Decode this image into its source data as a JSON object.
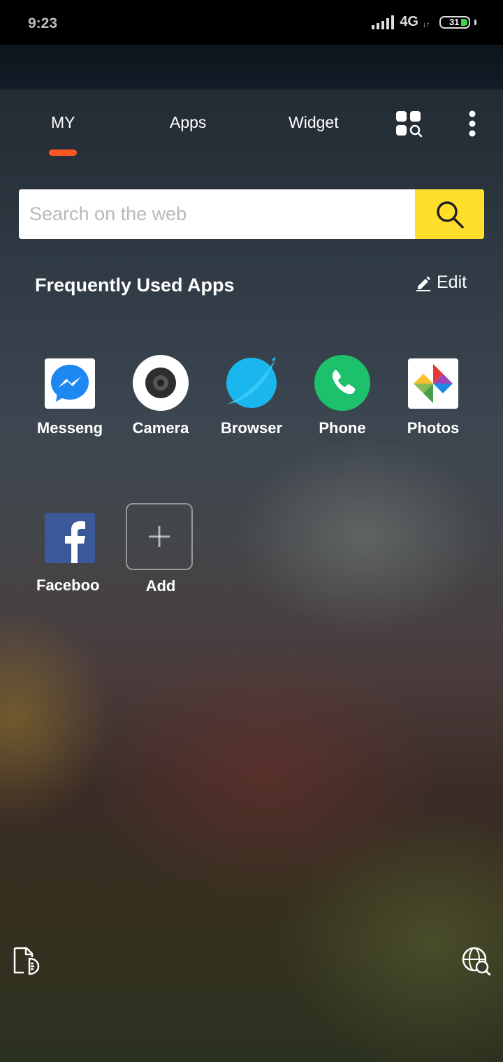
{
  "status_bar": {
    "time": "9:23",
    "network": "4G",
    "network_sub": "↓↑",
    "battery": "31",
    "battery_color": "#3fd34b"
  },
  "tabs": [
    {
      "label": "MY",
      "active": true
    },
    {
      "label": "Apps",
      "active": false
    },
    {
      "label": "Widget",
      "active": false
    }
  ],
  "accent_color": "#ff5722",
  "search": {
    "placeholder": "Search on the web",
    "button_color": "#ffdf2c",
    "button_icon": "search-icon"
  },
  "frequent": {
    "title": "Frequently Used Apps",
    "edit_label": "Edit",
    "apps": [
      {
        "label": "Messeng",
        "icon": "messenger-icon"
      },
      {
        "label": "Camera",
        "icon": "camera-icon"
      },
      {
        "label": "Browser",
        "icon": "browser-icon"
      },
      {
        "label": "Phone",
        "icon": "phone-icon"
      },
      {
        "label": "Photos",
        "icon": "photos-icon"
      },
      {
        "label": "Faceboo",
        "icon": "facebook-icon"
      }
    ],
    "add_label": "Add"
  },
  "bottom": {
    "left_icon": "document-icon",
    "right_icon": "web-search-icon"
  }
}
